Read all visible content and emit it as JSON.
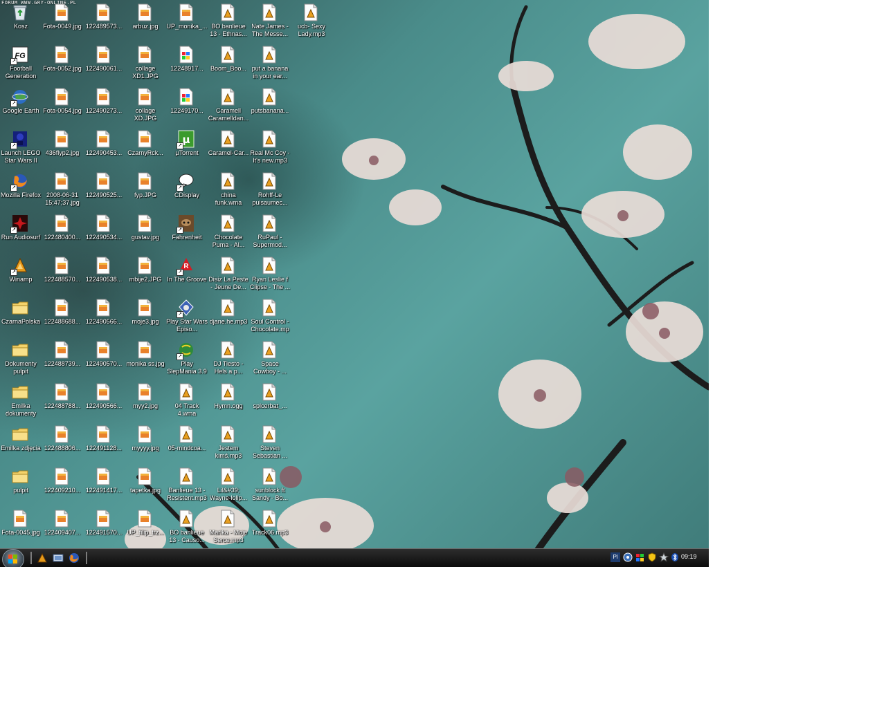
{
  "watermark": "FORUM WWW.GRY-ONLINE.PL",
  "desktop": {
    "columns": [
      [
        {
          "label": "Kosz",
          "icon": "recycle-bin-icon"
        },
        {
          "label": "Football Generation",
          "icon": "game-shortcut-icon"
        },
        {
          "label": "Google Earth",
          "icon": "google-earth-icon"
        },
        {
          "label": "Launch LEGO Star Wars II",
          "icon": "lego-star-wars-icon"
        },
        {
          "label": "Mozilla Firefox",
          "icon": "firefox-icon"
        },
        {
          "label": "Run Audiosurf",
          "icon": "audiosurf-icon"
        },
        {
          "label": "Winamp",
          "icon": "winamp-icon"
        },
        {
          "label": "CzarnaPolska",
          "icon": "folder-icon"
        },
        {
          "label": "Dokumenty pulpit",
          "icon": "folder-icon"
        },
        {
          "label": "Emilka dokumenty",
          "icon": "folder-icon"
        },
        {
          "label": "Emilka zdjęcia",
          "icon": "folder-icon"
        },
        {
          "label": "pulpit",
          "icon": "folder-icon"
        },
        {
          "label": "Fota-0045.jpg",
          "icon": "image-file-icon"
        }
      ],
      [
        {
          "label": "Fota-0049.jpg",
          "icon": "image-file-icon"
        },
        {
          "label": "Fota-0052.jpg",
          "icon": "image-file-icon"
        },
        {
          "label": "Fota-0054.jpg",
          "icon": "image-file-icon"
        },
        {
          "label": "436flyp2.jpg",
          "icon": "image-file-icon"
        },
        {
          "label": "2008-06-31 15;47;37.jpg",
          "icon": "image-file-icon"
        },
        {
          "label": "122480400...",
          "icon": "image-file-icon"
        },
        {
          "label": "122488570...",
          "icon": "image-file-icon"
        },
        {
          "label": "122488688...",
          "icon": "image-file-icon"
        },
        {
          "label": "122488739...",
          "icon": "image-file-icon"
        },
        {
          "label": "122488788...",
          "icon": "image-file-icon"
        },
        {
          "label": "122488806...",
          "icon": "image-file-icon"
        },
        {
          "label": "122409210...",
          "icon": "image-file-icon"
        },
        {
          "label": "122409407...",
          "icon": "image-file-icon"
        }
      ],
      [
        {
          "label": "122489573...",
          "icon": "image-file-icon"
        },
        {
          "label": "122490061...",
          "icon": "image-file-icon"
        },
        {
          "label": "122490273...",
          "icon": "image-file-icon"
        },
        {
          "label": "122490453...",
          "icon": "image-file-icon"
        },
        {
          "label": "122490525...",
          "icon": "image-file-icon"
        },
        {
          "label": "122490534...",
          "icon": "image-file-icon"
        },
        {
          "label": "122490538...",
          "icon": "image-file-icon"
        },
        {
          "label": "122490566...",
          "icon": "image-file-icon"
        },
        {
          "label": "122490570...",
          "icon": "image-file-icon"
        },
        {
          "label": "122490566...",
          "icon": "image-file-icon"
        },
        {
          "label": "122491128...",
          "icon": "image-file-icon"
        },
        {
          "label": "122491417...",
          "icon": "image-file-icon"
        },
        {
          "label": "122491570...",
          "icon": "image-file-icon"
        }
      ],
      [
        {
          "label": "arbuz.jpg",
          "icon": "image-file-icon"
        },
        {
          "label": "collage XD1.JPG",
          "icon": "image-file-icon"
        },
        {
          "label": "collage XD.JPG",
          "icon": "image-file-icon"
        },
        {
          "label": "CzarnyRck...",
          "icon": "image-file-icon"
        },
        {
          "label": "fyp.JPG",
          "icon": "image-file-icon"
        },
        {
          "label": "gustav.jpg",
          "icon": "image-file-icon"
        },
        {
          "label": "mbije2.JPG",
          "icon": "image-file-icon"
        },
        {
          "label": "moje3.jpg",
          "icon": "image-file-icon"
        },
        {
          "label": "monika ss.jpg",
          "icon": "image-file-icon"
        },
        {
          "label": "myy2.jpg",
          "icon": "image-file-icon"
        },
        {
          "label": "myyyy.jpg",
          "icon": "image-file-icon"
        },
        {
          "label": "tapetka.jpg",
          "icon": "image-file-icon"
        },
        {
          "label": "UP_filip_trz...",
          "icon": "image-file-icon"
        }
      ],
      [
        {
          "label": "UP_monika_...",
          "icon": "image-file-icon"
        },
        {
          "label": "12248917...",
          "icon": "paint-file-icon"
        },
        {
          "label": "12249170...",
          "icon": "paint-file-icon"
        },
        {
          "label": "µTorrent",
          "icon": "utorrent-icon"
        },
        {
          "label": "CDisplay",
          "icon": "cdisplay-icon"
        },
        {
          "label": "Fahrenheit",
          "icon": "fahrenheit-icon"
        },
        {
          "label": "In The Groove",
          "icon": "in-the-groove-icon"
        },
        {
          "label": "Play Star Wars Episo...",
          "icon": "star-wars-icon"
        },
        {
          "label": "Play SlepMania 3.9",
          "icon": "stepmania-icon"
        },
        {
          "label": "04 Track 4.wma",
          "icon": "audio-file-icon"
        },
        {
          "label": "05-mindcoa...",
          "icon": "audio-file-icon"
        },
        {
          "label": "Banlieue 13 - Resistent.mp3",
          "icon": "audio-file-icon"
        },
        {
          "label": "BO banlieue 13 - Causo...",
          "icon": "audio-file-icon"
        }
      ],
      [
        {
          "label": "BO banlieue 13 - Ethnas...",
          "icon": "audio-file-icon"
        },
        {
          "label": "Boom_Boo...",
          "icon": "audio-file-icon"
        },
        {
          "label": "Caramell Caramelldan...",
          "icon": "audio-file-icon"
        },
        {
          "label": "Caramel-Car...",
          "icon": "audio-file-icon"
        },
        {
          "label": "china funk.wma",
          "icon": "audio-file-icon"
        },
        {
          "label": "Chocolate Puma - Al...",
          "icon": "audio-file-icon"
        },
        {
          "label": "Disiz La Peste - Jeune De...",
          "icon": "audio-file-icon"
        },
        {
          "label": "djane.he.mp3",
          "icon": "audio-file-icon"
        },
        {
          "label": "DJ Tiesto - Hels a p...",
          "icon": "audio-file-icon"
        },
        {
          "label": "Hymn.ogg",
          "icon": "audio-file-icon"
        },
        {
          "label": "Jestem kimś.mp3",
          "icon": "audio-file-icon"
        },
        {
          "label": "Lil&#39; Wayne-lolip...",
          "icon": "audio-file-icon"
        },
        {
          "label": "Marika - Moje Serce.mp3",
          "icon": "audio-file-icon"
        }
      ],
      [
        {
          "label": "Nate James - The Messe...",
          "icon": "audio-file-icon"
        },
        {
          "label": "put a banana in your ear...",
          "icon": "audio-file-icon"
        },
        {
          "label": "putsbanana...",
          "icon": "audio-file-icon"
        },
        {
          "label": "Real Mc Coy - It's new.mp3",
          "icon": "audio-file-icon"
        },
        {
          "label": "Rohff-Le puisaumec...",
          "icon": "audio-file-icon"
        },
        {
          "label": "RuPaul - Supermod...",
          "icon": "audio-file-icon"
        },
        {
          "label": "Ryan Leslie f Clipse - The ...",
          "icon": "audio-file-icon"
        },
        {
          "label": "Soul Control - Chocolate.mp3",
          "icon": "audio-file-icon"
        },
        {
          "label": "Space Cowboy - ...",
          "icon": "audio-file-icon"
        },
        {
          "label": "splcerbat_...",
          "icon": "audio-file-icon"
        },
        {
          "label": "Steven Sebastian ...",
          "icon": "audio-file-icon"
        },
        {
          "label": "sunblock ft Sandy - Bo...",
          "icon": "audio-file-icon"
        },
        {
          "label": "Track06.mp3",
          "icon": "audio-file-icon"
        }
      ],
      [
        {
          "label": "ucb- Sexy Lady.mp3",
          "icon": "audio-file-icon"
        }
      ]
    ]
  },
  "taskbar": {
    "start_button": "start-orb-icon",
    "quick_launch": [
      "winamp-icon",
      "show-desktop-icon",
      "firefox-icon"
    ],
    "tray": {
      "language": "Pl",
      "icons": [
        "network-icon",
        "volume-icon",
        "security-shield-icon",
        "star-icon",
        "bluetooth-icon"
      ],
      "clock": "09:19"
    }
  },
  "colors": {
    "wallpaper_teal": "#4a8c8a",
    "taskbar": "#0b0b0b",
    "label_text": "#ffffff"
  }
}
